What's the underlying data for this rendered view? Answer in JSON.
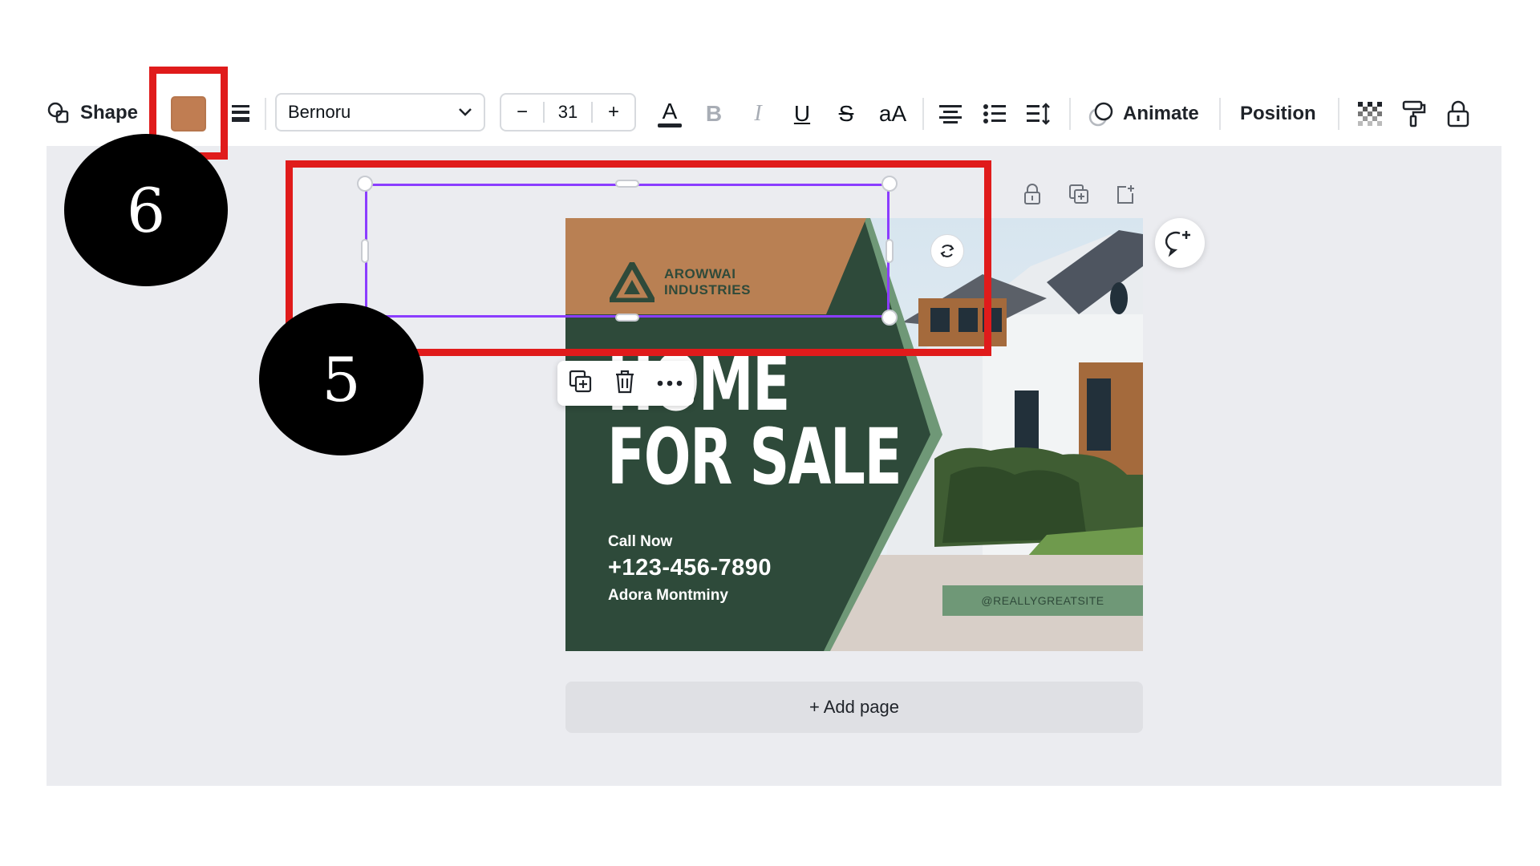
{
  "toolbar": {
    "shape_label": "Shape",
    "fill_color": "#c07d52",
    "font_name": "Bernoru",
    "font_size": "31",
    "size_minus": "−",
    "size_plus": "+",
    "case_label": "aA",
    "animate_label": "Animate",
    "position_label": "Position",
    "bold_label": "B",
    "italic_label": "I",
    "underline_label": "U",
    "strike_label": "S",
    "text_color_label": "A"
  },
  "design": {
    "brand_line1": "AROWWAI",
    "brand_line2": "INDUSTRIES",
    "headline_line1": "HOME",
    "headline_line2": "FOR SALE",
    "call_label": "Call Now",
    "phone": "+123-456-7890",
    "agent_name": "Adora Montminy",
    "website": "@REALLYGREATSITE",
    "colors": {
      "dark_green": "#2e4a3a",
      "tan": "#b98053",
      "sage": "#6f9877"
    }
  },
  "canvas": {
    "add_page_label": "+ Add page"
  },
  "annotations": {
    "marker_6": "6",
    "marker_5": "5",
    "box_color": "#e01b1b"
  }
}
